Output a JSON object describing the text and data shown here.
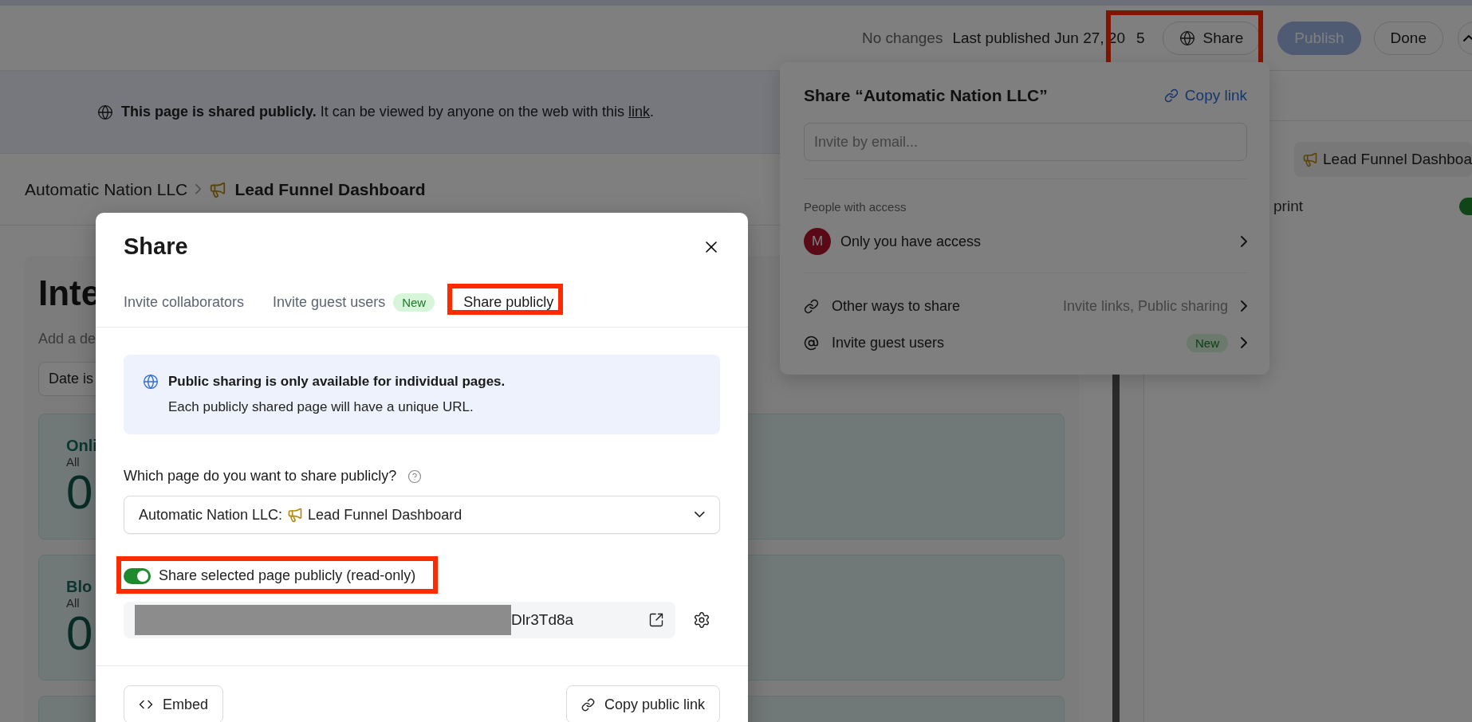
{
  "header": {
    "status": "No changes",
    "last_published": "Last published Jun 27, 20",
    "last_published_tail": "5",
    "share_button": {
      "label": "Share",
      "highlighted": true
    },
    "buttons": [
      {
        "label": "Publish",
        "kind": "primary"
      },
      {
        "label": "Done",
        "kind": "secondary"
      }
    ]
  },
  "banner": {
    "lead": "This page is shared publicly.",
    "text": "It can be viewed by anyone on the web with this",
    "link": "link",
    "end": "."
  },
  "breadcrumb": [
    {
      "label": "Automatic Nation LLC",
      "current": false
    },
    {
      "label": "Lead Funnel Dashboard",
      "current": true
    }
  ],
  "page": {
    "title": "Inte",
    "description": "Add a de",
    "filter": "Date is",
    "cards": [
      {
        "kind": "stat",
        "title": "Onli",
        "subtitle": "All",
        "value": "0"
      },
      {
        "kind": "stat",
        "title": "Blo",
        "subtitle": "All",
        "value": "0"
      },
      {
        "kind": "blank"
      }
    ]
  },
  "side_panel": {
    "chip": "Lead Funnel Dashboa",
    "option": "print",
    "toggle_on": true
  },
  "popover": {
    "title": "Share “Automatic Nation LLC”",
    "copy_link": "Copy link",
    "invite_placeholder": "Invite by email...",
    "section_label": "People with access",
    "access": {
      "avatar": "M",
      "label": "Only you have access"
    },
    "rows": [
      {
        "kind": "link",
        "label": "Other ways to share",
        "detail": "Invite links, Public sharing"
      },
      {
        "kind": "at",
        "label": "Invite guest users",
        "badge": "New"
      }
    ]
  },
  "dialog": {
    "title": "Share",
    "tabs": [
      {
        "label": "Invite collaborators",
        "selected": false,
        "highlighted": false
      },
      {
        "label": "Invite guest users",
        "badge": "New",
        "selected": false,
        "highlighted": false
      },
      {
        "label": "Share publicly",
        "selected": true,
        "highlighted": true
      }
    ],
    "notice": {
      "title": "Public sharing is only available for individual pages.",
      "body": "Each publicly shared page will have a unique URL."
    },
    "question": "Which page do you want to share publicly?",
    "page_select": {
      "prefix": "Automatic Nation LLC:",
      "name": "Lead Funnel Dashboard"
    },
    "toggle": {
      "label": "Share selected page publicly (read-only)",
      "on": true,
      "highlighted": true
    },
    "url": "Dlr3Td8a",
    "footer": {
      "embed": "Embed",
      "copy": "Copy public link"
    }
  }
}
